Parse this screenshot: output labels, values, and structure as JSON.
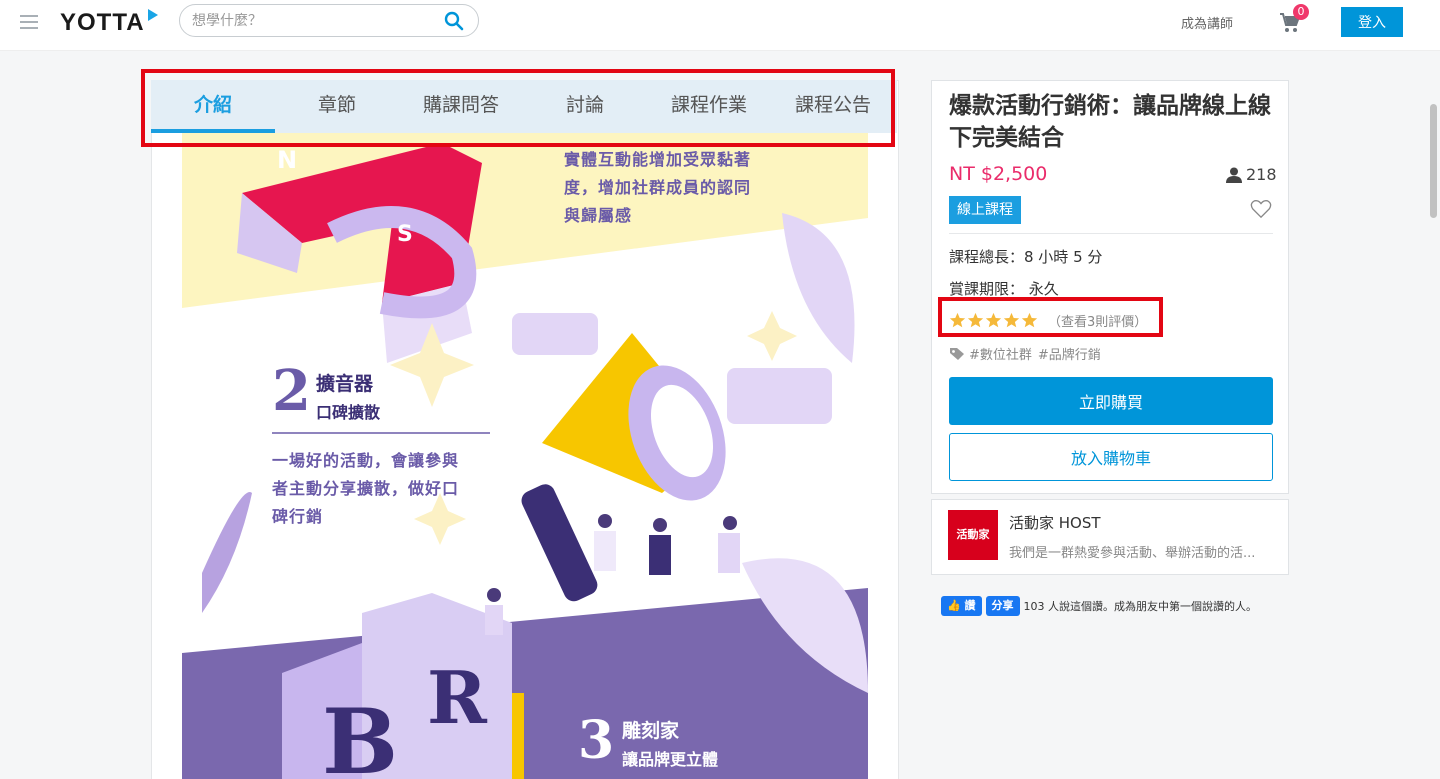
{
  "header": {
    "logo_text": "YOTTA",
    "search_placeholder": "想學什麼？",
    "become_teacher": "成為講師",
    "cart_count": "0",
    "login": "登入"
  },
  "tabs": [
    {
      "label": "介紹",
      "active": true
    },
    {
      "label": "章節"
    },
    {
      "label": "購課問答"
    },
    {
      "label": "討論"
    },
    {
      "label": "課程作業"
    },
    {
      "label": "課程公告"
    }
  ],
  "banner": {
    "section1_text": [
      "實體互動能增加受眾黏著",
      "度，增加社群成員的認同",
      "與歸屬感"
    ],
    "section2_number": "2",
    "section2_title": "擴音器",
    "section2_subtitle": "口碑擴散",
    "section2_text": [
      "一場好的活動，會讓參與",
      "者主動分享擴散，做好口",
      "碑行銷"
    ],
    "section3_number": "3",
    "section3_title": "雕刻家",
    "section3_subtitle": "讓品牌更立體"
  },
  "course": {
    "title": "爆款活動行銷術：讓品牌線上線下完美結合",
    "price": "NT $2,500",
    "students": "218",
    "type_tag": "線上課程",
    "duration": "課程總長：8 小時 5 分",
    "access": "賞課期限： 永久",
    "rating": 5,
    "review_link": "（查看3則評價）",
    "tags": [
      "#數位社群",
      "#品牌行銷"
    ],
    "buy_now": "立即購買",
    "add_to_cart": "放入購物車"
  },
  "host": {
    "logo_text": "活動家",
    "name": "活動家 HOST",
    "desc": "我們是一群熱愛參與活動、舉辦活動的活..."
  },
  "facebook": {
    "like": "讚",
    "share": "分享",
    "text": "103 人說這個讚。成為朋友中第一個說讚的人。"
  },
  "colors": {
    "brand_blue": "#0095d9",
    "price_pink": "#ea2c6b",
    "star": "#f5b93a",
    "highlight_red": "#e30613"
  }
}
